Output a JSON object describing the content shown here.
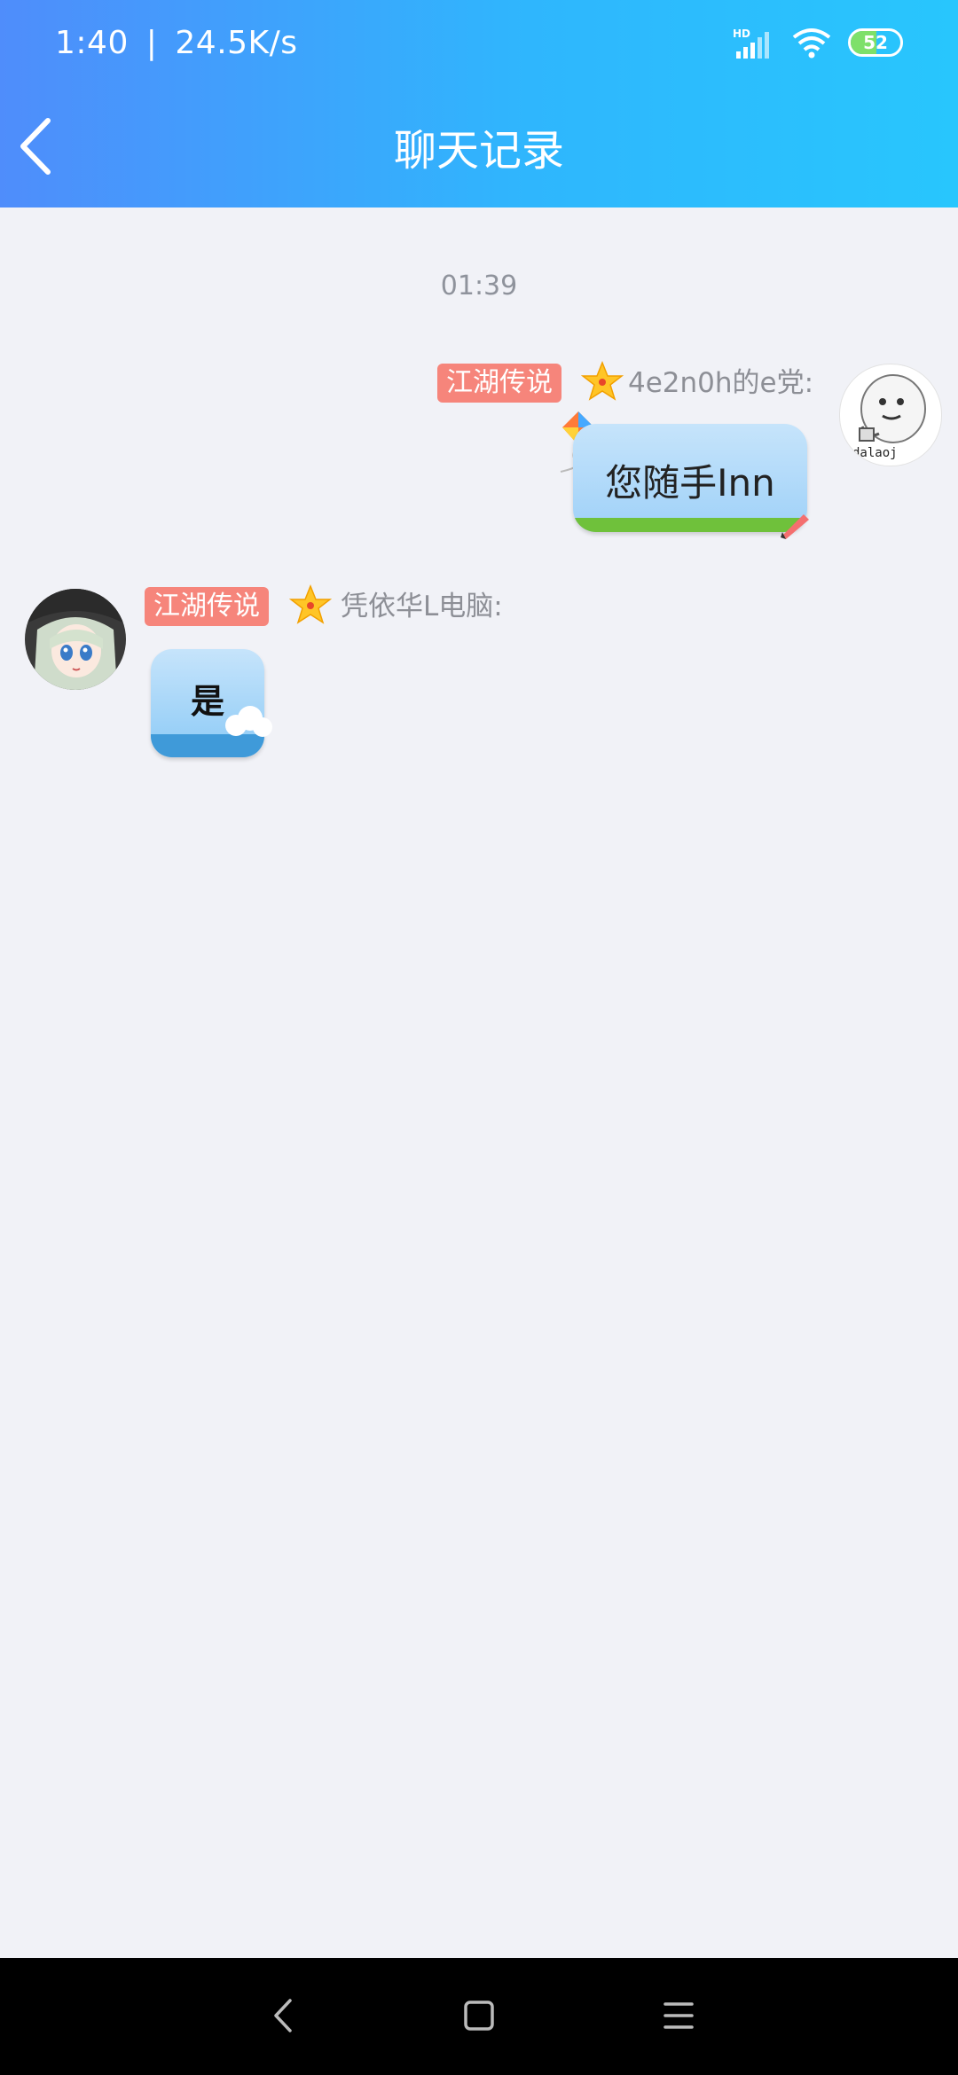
{
  "status_bar": {
    "time": "1:40",
    "speed": "24.5K/s",
    "network": "HD",
    "battery": "52",
    "battery_level": 52
  },
  "header": {
    "title": "聊天记录",
    "back_icon": "chevron-left-icon"
  },
  "chat": {
    "time_divider": "01:39",
    "messages": [
      {
        "side": "right",
        "badge": "江湖传说",
        "sender": "4e2n0h的e党:",
        "text": "您随手Inn",
        "avatar_caption": "dalaoj"
      },
      {
        "side": "left",
        "badge": "江湖传说",
        "sender": "凭依华L电脑:",
        "text": "是"
      }
    ]
  },
  "nav_bar": {
    "back": "back-nav-icon",
    "home": "home-nav-icon",
    "menu": "menu-nav-icon"
  },
  "colors": {
    "header_start": "#4f8dfb",
    "header_end": "#28c6fd",
    "badge": "#f6857b",
    "background": "#f1f2f7"
  }
}
